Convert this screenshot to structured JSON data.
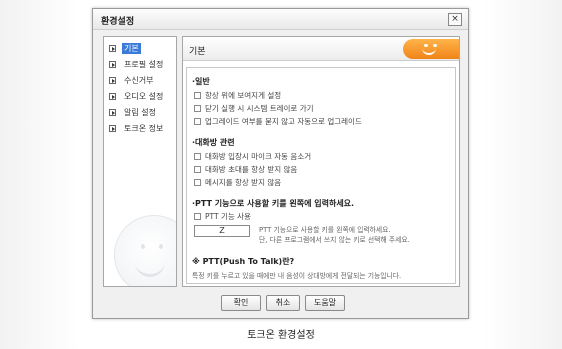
{
  "window": {
    "title": "환경설정",
    "close_label": "×"
  },
  "sidebar": {
    "items": [
      {
        "label": "기본",
        "active": true
      },
      {
        "label": "프로필 설정",
        "active": false
      },
      {
        "label": "수신거부",
        "active": false
      },
      {
        "label": "오디오 설정",
        "active": false
      },
      {
        "label": "알림 설정",
        "active": false
      },
      {
        "label": "토크온 정보",
        "active": false
      }
    ]
  },
  "panel": {
    "title": "기본",
    "sections": {
      "general": {
        "title": "·일반",
        "options": [
          {
            "label": "항상 위에 보여지게 설정",
            "checked": false
          },
          {
            "label": "닫기 실행 시 시스템 트레이로 가기",
            "checked": false
          },
          {
            "label": "업그레이드 여부를 묻지 않고 자동으로 업그레이드",
            "checked": false
          }
        ]
      },
      "chat": {
        "title": "·대화방 관련",
        "options": [
          {
            "label": "대화방 입장시 마이크 자동 음소거",
            "checked": false
          },
          {
            "label": "대화방 초대를 항상 받지 않음",
            "checked": false
          },
          {
            "label": "메시지를 항상 받지 않음",
            "checked": false
          }
        ]
      },
      "ptt": {
        "title": "·PTT 기능으로 사용할 키를 왼쪽에 입력하세요.",
        "option": {
          "label": "PTT 기능 사용",
          "checked": false
        },
        "key_value": "Z",
        "help_line1": "PTT 기능으로 사용할 키를 왼쪽에 입력하세요.",
        "help_line2": "단, 다른 프로그램에서 쓰지 않는 키로 선택해 주세요.",
        "faq_title": "※ PTT(Push To Talk)란?",
        "faq_desc": "특정 키를 누르고 있을 때에만 내 음성이 상대방에게 전달되는 기능입니다."
      }
    }
  },
  "buttons": {
    "ok": "확인",
    "cancel": "취소",
    "help": "도움말"
  },
  "caption": "토크온 환경설정",
  "colors": {
    "accent_orange": "#f08418",
    "selection_blue": "#3b7bd8"
  }
}
